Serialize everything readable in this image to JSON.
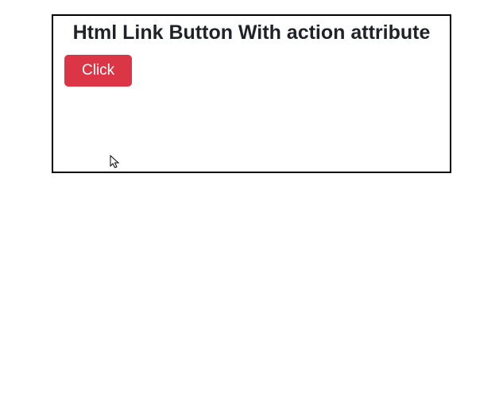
{
  "heading": "Html Link Button With action attribute",
  "button_label": "Click",
  "colors": {
    "button_bg": "#dc3545",
    "button_text": "#ffffff",
    "border": "#000000",
    "heading": "#1f2328"
  }
}
